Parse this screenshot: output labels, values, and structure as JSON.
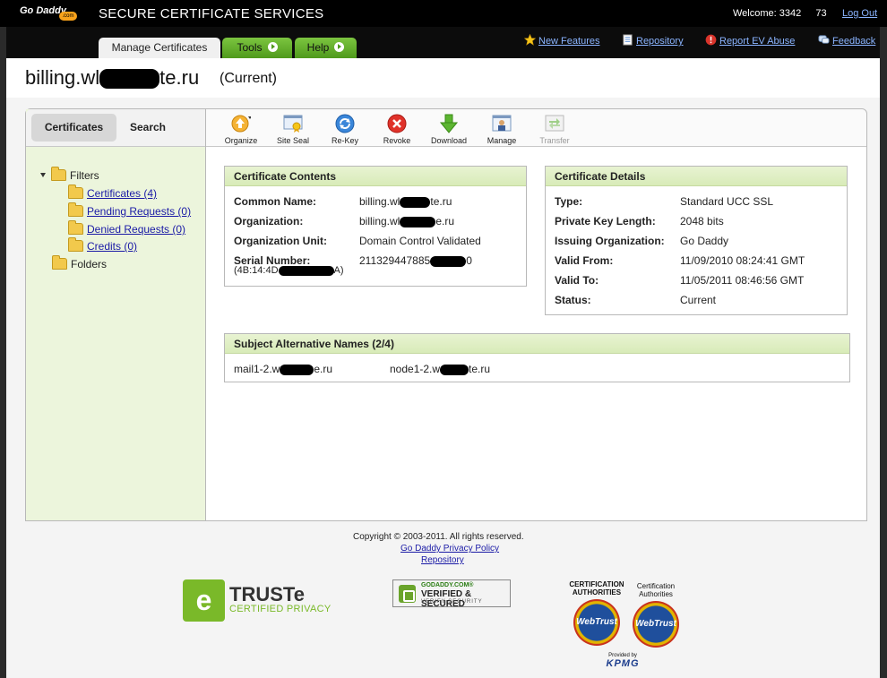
{
  "header": {
    "logo_text": "Go Daddy",
    "logo_suffix": ".com",
    "app_title": "SECURE CERTIFICATE SERVICES",
    "welcome": "Welcome: 3342",
    "welcome_tail": "73",
    "logout": "Log Out"
  },
  "nav": {
    "tabs": [
      {
        "label": "Manage Certificates"
      },
      {
        "label": "Tools"
      },
      {
        "label": "Help"
      }
    ],
    "links": {
      "new_features": "New Features",
      "repository": "Repository",
      "report_ev_abuse": "Report EV Abuse",
      "feedback": "Feedback"
    }
  },
  "page": {
    "title_start": "billing.wl",
    "title_end": "te.ru",
    "status": "(Current)"
  },
  "sidebar": {
    "tabs": {
      "certificates": "Certificates",
      "search": "Search"
    },
    "filters_label": "Filters",
    "filters": [
      {
        "label": "Certificates (4)"
      },
      {
        "label": "Pending Requests (0)"
      },
      {
        "label": "Denied Requests (0)"
      },
      {
        "label": "Credits (0)"
      }
    ],
    "folders_label": "Folders"
  },
  "toolbar": {
    "items": [
      {
        "label": "Organize",
        "icon": "organize-icon"
      },
      {
        "label": "Site Seal",
        "icon": "site-seal-icon"
      },
      {
        "label": "Re-Key",
        "icon": "rekey-icon"
      },
      {
        "label": "Revoke",
        "icon": "revoke-icon"
      },
      {
        "label": "Download",
        "icon": "download-icon"
      },
      {
        "label": "Manage",
        "icon": "manage-icon"
      },
      {
        "label": "Transfer",
        "icon": "transfer-icon"
      }
    ]
  },
  "contents": {
    "title": "Certificate Contents",
    "rows": [
      {
        "label": "Common Name:",
        "value_start": "billing.wl",
        "value_end": "te.ru"
      },
      {
        "label": "Organization:",
        "value_start": "billing.wl",
        "value_end": "e.ru"
      },
      {
        "label": "Organization Unit:",
        "value": "Domain Control Validated"
      },
      {
        "label": "Serial Number:",
        "value_start": "211329447885",
        "value_end": "0"
      }
    ],
    "serial_hex_start": "(4B:14:4D",
    "serial_hex_end": "A)"
  },
  "details": {
    "title": "Certificate Details",
    "rows": [
      {
        "label": "Type:",
        "value": "Standard UCC SSL"
      },
      {
        "label": "Private Key Length:",
        "value": "2048 bits"
      },
      {
        "label": "Issuing Organization:",
        "value": "Go Daddy"
      },
      {
        "label": "Valid From:",
        "value": "11/09/2010 08:24:41 GMT"
      },
      {
        "label": "Valid To:",
        "value": "11/05/2011 08:46:56 GMT"
      },
      {
        "label": "Status:",
        "value": "Current"
      }
    ]
  },
  "san": {
    "title": "Subject Alternative Names (2/4)",
    "names": [
      {
        "start": "mail1-2.w",
        "end": "e.ru"
      },
      {
        "start": "node1-2.w",
        "end": "te.ru"
      }
    ]
  },
  "footer": {
    "copyright": "Copyright © 2003-2011. All rights reserved.",
    "privacy_link": "Go Daddy Privacy Policy",
    "repository_link": "Repository"
  },
  "seals": {
    "truste_letter": "e",
    "truste_name": "TRUSTe",
    "truste_sub": "CERTIFIED PRIVACY",
    "godaddy_line1": "GODADDY.COM®",
    "godaddy_line2": "VERIFIED & SECURED",
    "godaddy_line3": "VERIFY SECURITY",
    "webtrust1_caption": "CERTIFICATION AUTHORITIES",
    "webtrust2_caption": "Certification Authorities",
    "webtrust_label": "WebTrust",
    "kpmg_caption": "Provided by",
    "kpmg_mark": "KPMG"
  }
}
